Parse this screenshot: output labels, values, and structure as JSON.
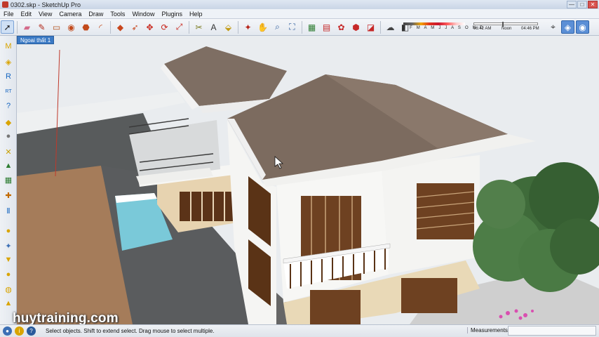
{
  "window": {
    "title": "0302.skp - SketchUp Pro",
    "min": "—",
    "max": "□",
    "close": "✕"
  },
  "menu": [
    "File",
    "Edit",
    "View",
    "Camera",
    "Draw",
    "Tools",
    "Window",
    "Plugins",
    "Help"
  ],
  "toolbar": {
    "tools": [
      {
        "name": "select-icon",
        "glyph": "➚",
        "color": "#222"
      },
      {
        "name": "eraser-icon",
        "glyph": "▰",
        "color": "#d46a8a"
      },
      {
        "name": "pencil-icon",
        "glyph": "✎",
        "color": "#b32a1b"
      },
      {
        "name": "rectangle-icon",
        "glyph": "▭",
        "color": "#b5541e"
      },
      {
        "name": "circle-icon",
        "glyph": "◉",
        "color": "#c24a1b"
      },
      {
        "name": "polygon-icon",
        "glyph": "⬣",
        "color": "#c24a1b"
      },
      {
        "name": "arc-icon",
        "glyph": "◜",
        "color": "#c24a1b"
      },
      {
        "name": "push-pull-icon",
        "glyph": "◆",
        "color": "#c8461c"
      },
      {
        "name": "follow-me-icon",
        "glyph": "➶",
        "color": "#c8461c"
      },
      {
        "name": "move-icon",
        "glyph": "✥",
        "color": "#c8261c"
      },
      {
        "name": "rotate-icon",
        "glyph": "⟳",
        "color": "#c8261c"
      },
      {
        "name": "scale-icon",
        "glyph": "⤢",
        "color": "#c8261c"
      },
      {
        "name": "tape-measure-icon",
        "glyph": "✂",
        "color": "#7a7a1e"
      },
      {
        "name": "text-icon",
        "glyph": "A",
        "color": "#333"
      },
      {
        "name": "paint-bucket-icon",
        "glyph": "⬙",
        "color": "#c39b14"
      },
      {
        "name": "orbit-icon",
        "glyph": "✦",
        "color": "#b8261b"
      },
      {
        "name": "pan-icon",
        "glyph": "✋",
        "color": "#2b5b9c"
      },
      {
        "name": "zoom-icon",
        "glyph": "⌕",
        "color": "#2b5b9c"
      },
      {
        "name": "zoom-extents-icon",
        "glyph": "⛶",
        "color": "#2b5b9c"
      },
      {
        "name": "get-models-icon",
        "glyph": "▦",
        "color": "#2e7d32"
      },
      {
        "name": "share-model-icon",
        "glyph": "▤",
        "color": "#c62828"
      },
      {
        "name": "components-icon",
        "glyph": "✿",
        "color": "#c62828"
      },
      {
        "name": "materials-icon",
        "glyph": "⬢",
        "color": "#c62828"
      },
      {
        "name": "styles-icon",
        "glyph": "◪",
        "color": "#c62828"
      },
      {
        "name": "sun-shadows-icon",
        "glyph": "☁",
        "color": "#444"
      },
      {
        "name": "fog-icon",
        "glyph": "◧",
        "color": "#333"
      }
    ],
    "shadow_months": "J F M A M J J A S O N D",
    "time_start": "06:42 AM",
    "time_noon": "Noon",
    "time_end": "04:46 PM",
    "view_tools": [
      {
        "name": "position-camera-icon",
        "glyph": "⌖",
        "color": "#333"
      },
      {
        "name": "walk-icon",
        "glyph": "◈",
        "color": "#1565c0"
      },
      {
        "name": "look-around-icon",
        "glyph": "◉",
        "color": "#1565c0"
      }
    ]
  },
  "left_tools": [
    {
      "name": "map-icon",
      "glyph": "M",
      "color": "#d9a400"
    },
    {
      "name": "tag-icon",
      "glyph": "◈",
      "color": "#d9a400"
    },
    {
      "name": "r-tool-icon",
      "glyph": "R",
      "color": "#1565c0"
    },
    {
      "name": "rt-tool-icon",
      "glyph": "RT",
      "color": "#1565c0"
    },
    {
      "name": "help-icon",
      "glyph": "?",
      "color": "#1565c0"
    },
    {
      "name": "label-icon",
      "glyph": "◆",
      "color": "#d9a400"
    },
    {
      "name": "dot-icon",
      "glyph": "●",
      "color": "#777"
    },
    {
      "name": "x-tool-icon",
      "glyph": "✕",
      "color": "#c9a100"
    },
    {
      "name": "terrain-icon",
      "glyph": "▲",
      "color": "#2e7d32"
    },
    {
      "name": "stamp-icon",
      "glyph": "▦",
      "color": "#2e7d32"
    },
    {
      "name": "compass-icon",
      "glyph": "✚",
      "color": "#c26a00"
    },
    {
      "name": "pause-icon",
      "glyph": "Ⅱ",
      "color": "#1565c0"
    },
    {
      "name": "sphere-icon",
      "glyph": "●",
      "color": "#d9a400"
    },
    {
      "name": "wand-icon",
      "glyph": "✦",
      "color": "#3b6fb5"
    },
    {
      "name": "funnel-icon",
      "glyph": "▼",
      "color": "#d9a400"
    },
    {
      "name": "spot-icon",
      "glyph": "●",
      "color": "#d9a400"
    },
    {
      "name": "bulb-icon",
      "glyph": "◍",
      "color": "#d9a400"
    },
    {
      "name": "cone-icon",
      "glyph": "▲",
      "color": "#d9a400"
    }
  ],
  "scene": {
    "tab_label": "Ngoai thất 1",
    "watermark": "huytraining.com"
  },
  "status": {
    "message": "Select objects. Shift to extend select. Drag mouse to select multiple.",
    "measurements_label": "Measurements",
    "measurements_value": ""
  }
}
